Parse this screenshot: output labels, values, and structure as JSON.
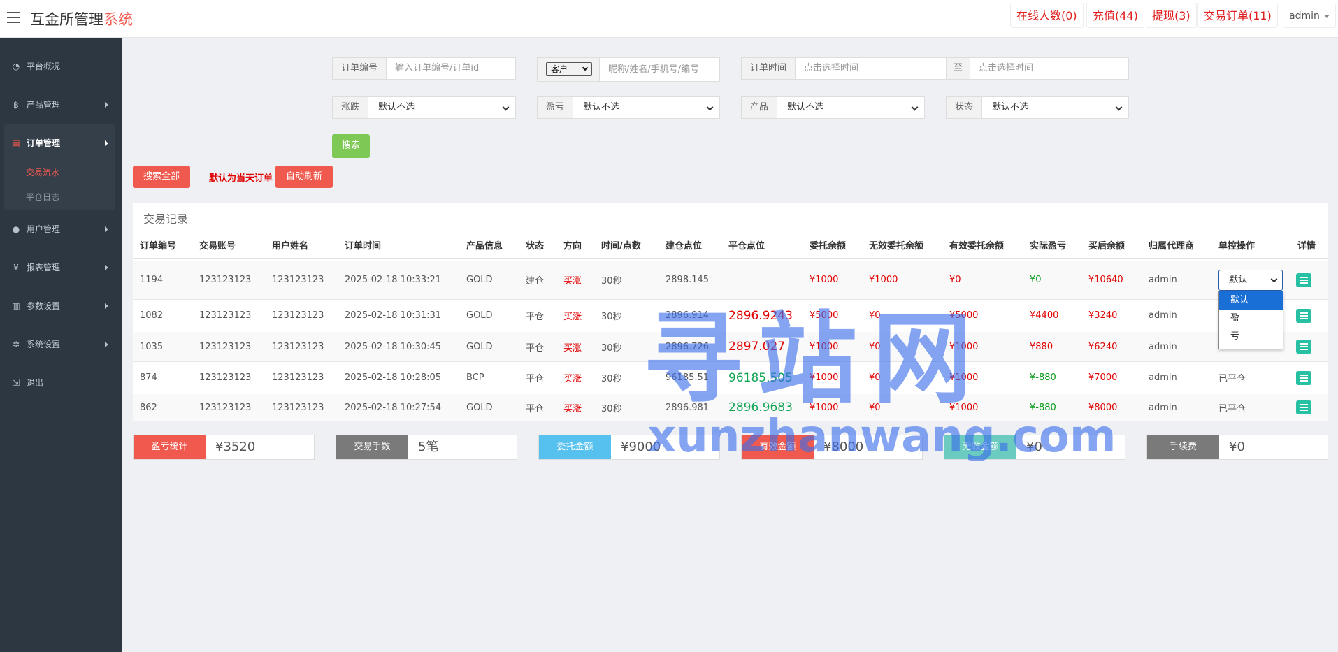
{
  "header": {
    "brand_main": "互金所管理",
    "brand_accent": "系统",
    "buttons": [
      "在线人数(0)",
      "充值(44)",
      "提现(3)",
      "交易订单(11)"
    ],
    "user": "admin"
  },
  "sidebar": {
    "items": [
      {
        "icon": "dashboard-icon",
        "glyph": "◔",
        "label": "平台概况"
      },
      {
        "icon": "bitcoin-icon",
        "glyph": "฿",
        "label": "产品管理"
      },
      {
        "icon": "orders-icon",
        "glyph": "▤",
        "label": "订单管理"
      },
      {
        "icon": "user-icon",
        "glyph": "●",
        "label": "用户管理"
      },
      {
        "icon": "yen-icon",
        "glyph": "¥",
        "label": "报表管理"
      },
      {
        "icon": "params-icon",
        "glyph": "▥",
        "label": "参数设置"
      },
      {
        "icon": "gears-icon",
        "glyph": "✲",
        "label": "系统设置"
      },
      {
        "icon": "logout-icon",
        "glyph": "⇲",
        "label": "退出"
      }
    ],
    "sub_items": [
      "交易流水",
      "平仓日志"
    ]
  },
  "filters": {
    "order_no_label": "订单编号",
    "order_no_placeholder": "输入订单编号/订单id",
    "customer_select": "客户",
    "customer_placeholder": "昵称/姓名/手机号/编号",
    "time_label": "订单时间",
    "time_start_placeholder": "点击选择时间",
    "time_to": "至",
    "time_end_placeholder": "点击选择时间",
    "rise_fall_label": "涨跌",
    "profit_loss_label": "盈亏",
    "product_label": "产品",
    "status_label": "状态",
    "default_option": "默认不选",
    "search_button": "搜索",
    "search_all_button": "搜索全部",
    "default_today_note": "默认为当天订单",
    "auto_refresh_button": "自动刷新"
  },
  "table": {
    "title": "交易记录",
    "columns": [
      "订单编号",
      "交易账号",
      "用户姓名",
      "订单时间",
      "产品信息",
      "状态",
      "方向",
      "时间/点数",
      "建仓点位",
      "平仓点位",
      "委托余额",
      "无效委托余额",
      "有效委托余额",
      "实际盈亏",
      "买后余额",
      "归属代理商",
      "单控操作",
      "详情"
    ],
    "rows": [
      {
        "id": "1194",
        "account": "123123123",
        "name": "123123123",
        "time": "2025-02-18 10:33:21",
        "product": "GOLD",
        "status": "建仓",
        "direction": "买涨",
        "duration": "30秒",
        "open": "2898.145",
        "close": "",
        "close_color": "red",
        "entrust": "¥1000",
        "invalid": "¥1000",
        "valid": "¥0",
        "pnl": "¥0",
        "balance": "¥10640",
        "agent": "admin",
        "control": "默认"
      },
      {
        "id": "1082",
        "account": "123123123",
        "name": "123123123",
        "time": "2025-02-18 10:31:31",
        "product": "GOLD",
        "status": "平仓",
        "direction": "买涨",
        "duration": "30秒",
        "open": "2896.914",
        "close": "2896.9243",
        "close_color": "red",
        "entrust": "¥5000",
        "invalid": "¥0",
        "valid": "¥5000",
        "pnl": "¥4400",
        "balance": "¥3240",
        "agent": "admin",
        "control": ""
      },
      {
        "id": "1035",
        "account": "123123123",
        "name": "123123123",
        "time": "2025-02-18 10:30:45",
        "product": "GOLD",
        "status": "平仓",
        "direction": "买涨",
        "duration": "30秒",
        "open": "2896.726",
        "close": "2897.027",
        "close_color": "red",
        "entrust": "¥1000",
        "invalid": "¥0",
        "valid": "¥1000",
        "pnl": "¥880",
        "balance": "¥6240",
        "agent": "admin",
        "control": ""
      },
      {
        "id": "874",
        "account": "123123123",
        "name": "123123123",
        "time": "2025-02-18 10:28:05",
        "product": "BCP",
        "status": "平仓",
        "direction": "买涨",
        "duration": "30秒",
        "open": "96185.51",
        "close": "96185.505",
        "close_color": "green",
        "entrust": "¥1000",
        "invalid": "¥0",
        "valid": "¥1000",
        "pnl": "¥-880",
        "balance": "¥7000",
        "agent": "admin",
        "control": "已平仓"
      },
      {
        "id": "862",
        "account": "123123123",
        "name": "123123123",
        "time": "2025-02-18 10:27:54",
        "product": "GOLD",
        "status": "平仓",
        "direction": "买涨",
        "duration": "30秒",
        "open": "2896.981",
        "close": "2896.9683",
        "close_color": "green",
        "entrust": "¥1000",
        "invalid": "¥0",
        "valid": "¥1000",
        "pnl": "¥-880",
        "balance": "¥8000",
        "agent": "admin",
        "control": "已平仓"
      }
    ],
    "control_options": [
      "默认",
      "盈",
      "亏"
    ]
  },
  "stats": [
    {
      "label": "盈亏统计",
      "value": "¥3520",
      "color": "#f0594e"
    },
    {
      "label": "交易手数",
      "value": "5笔",
      "color": "#7a7a7a"
    },
    {
      "label": "委托金额",
      "value": "¥9000",
      "color": "#56c0ee"
    },
    {
      "label": "有效金额",
      "value": "¥8000",
      "color": "#f0594e"
    },
    {
      "label": "无效金额",
      "value": "¥0",
      "color": "#6ccbc0"
    },
    {
      "label": "手续费",
      "value": "¥0",
      "color": "#7a7a7a"
    }
  ],
  "watermark": {
    "line1": "寻站网",
    "line2": "xunzhanwang.com"
  }
}
